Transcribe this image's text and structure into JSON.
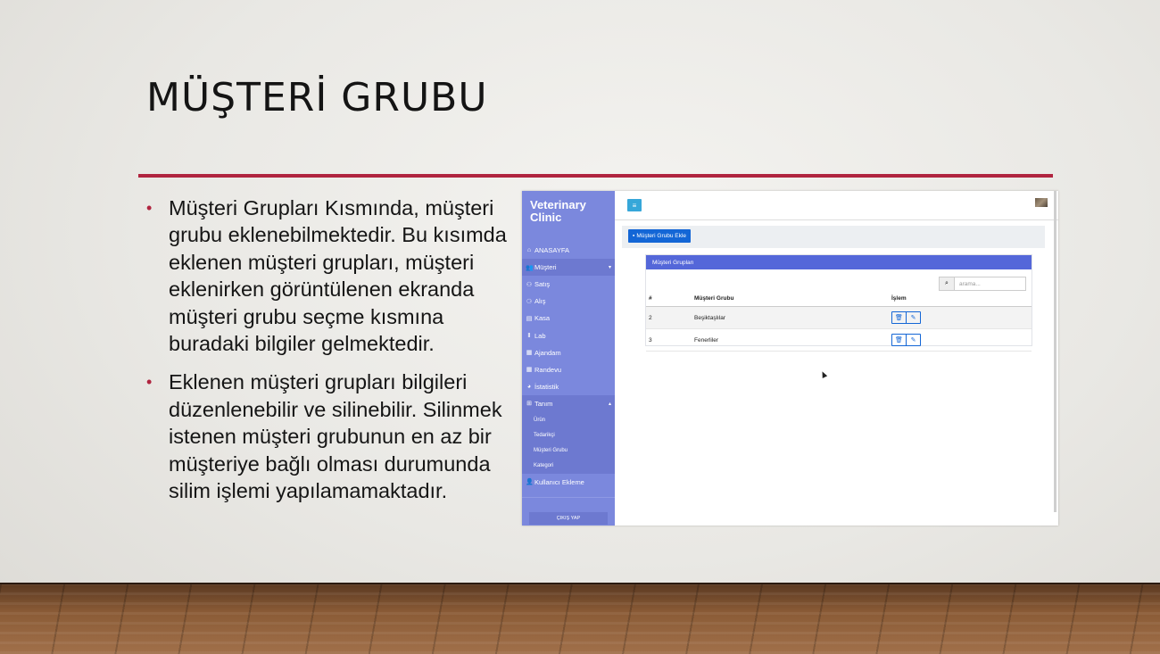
{
  "slide": {
    "title": "MÜŞTERİ GRUBU",
    "bullets": [
      "Müşteri Grupları Kısmında, müşteri grubu eklenebilmektedir. Bu kısımda eklenen müşteri grupları, müşteri eklenirken görüntülenen ekranda müşteri grubu seçme kısmına buradaki bilgiler gelmektedir.",
      "Eklenen müşteri grupları bilgileri düzenlenebilir ve silinebilir. Silinmek istenen müşteri grubunun en az bir müşteriye bağlı olması durumunda silim işlemi yapılamamaktadır."
    ],
    "accent_color": "#b0243f"
  },
  "app": {
    "brand": "Veterinary Clinic",
    "sidebar": {
      "items": [
        {
          "label": "ANASAYFA",
          "icon": "home-icon"
        },
        {
          "label": "Müşteri",
          "icon": "users-icon"
        },
        {
          "label": "Satış",
          "icon": "handshake-icon"
        },
        {
          "label": "Alış",
          "icon": "cart-icon"
        },
        {
          "label": "Kasa",
          "icon": "cash-register-icon"
        },
        {
          "label": "Lab",
          "icon": "flask-icon"
        },
        {
          "label": "Ajandam",
          "icon": "calendar-icon"
        },
        {
          "label": "Randevu",
          "icon": "calendar-check-icon"
        },
        {
          "label": "İstatistik",
          "icon": "chart-pie-icon"
        },
        {
          "label": "Tanım",
          "icon": "plus-square-icon"
        }
      ],
      "sub_items": [
        "Ürün",
        "Tedarikçi",
        "Müşteri Grubu",
        "Kategori"
      ],
      "user_add": "Kullanıcı Ekleme",
      "logout": "ÇIKIŞ YAP",
      "color": "#7b88dd"
    },
    "toolbar": {
      "add_button": "Müşteri Grubu Ekle"
    },
    "card": {
      "title": "Müşteri Grupları",
      "search_placeholder": "arama...",
      "columns": [
        "#",
        "Müşteri Grubu",
        "İşlem"
      ],
      "rows": [
        {
          "id": "2",
          "name": "Beşiktaşlılar"
        },
        {
          "id": "3",
          "name": "Fenerliler"
        }
      ]
    }
  }
}
